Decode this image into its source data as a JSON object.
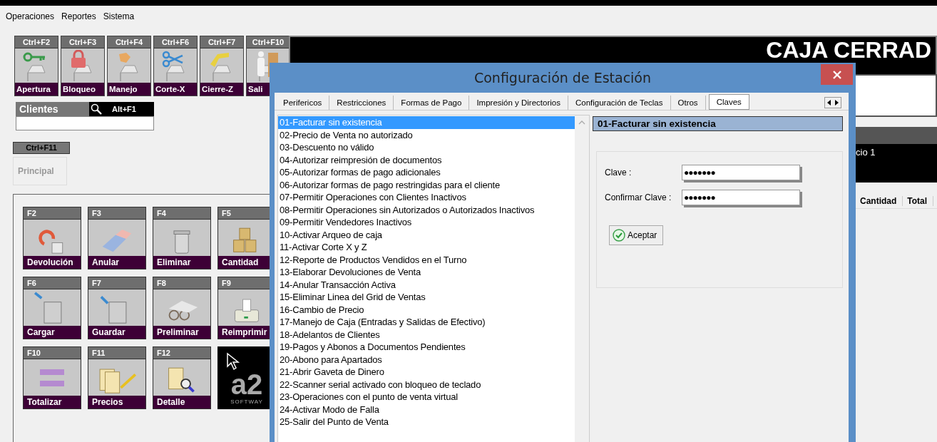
{
  "menu": [
    "Operaciones",
    "Reportes",
    "Sistema"
  ],
  "top_buttons": [
    {
      "shortcut": "Ctrl+F2",
      "label": "Apertura"
    },
    {
      "shortcut": "Ctrl+F3",
      "label": "Bloqueo"
    },
    {
      "shortcut": "Ctrl+F4",
      "label": "Manejo"
    },
    {
      "shortcut": "Ctrl+F6",
      "label": "Corte-X"
    },
    {
      "shortcut": "Ctrl+F7",
      "label": "Cierre-Z"
    },
    {
      "shortcut": "Ctrl+F10",
      "label": "Sali"
    }
  ],
  "clientes": {
    "label": "Clientes",
    "shortcut": "Alt+F1"
  },
  "principal": {
    "shortcut": "Ctrl+F11",
    "label": "Principal",
    "disabled": true
  },
  "function_keys": [
    {
      "key": "F2",
      "label": "Devolución"
    },
    {
      "key": "F3",
      "label": "Anular"
    },
    {
      "key": "F4",
      "label": "Eliminar"
    },
    {
      "key": "F5",
      "label": "Cantidad"
    },
    {
      "key": "F6",
      "label": "Cargar"
    },
    {
      "key": "F7",
      "label": "Guardar"
    },
    {
      "key": "F8",
      "label": "Preliminar"
    },
    {
      "key": "F9",
      "label": "Reimprimir"
    },
    {
      "key": "F10",
      "label": "Totalizar"
    },
    {
      "key": "F11",
      "label": "Precios"
    },
    {
      "key": "F12",
      "label": "Detalle"
    }
  ],
  "logo": {
    "text": "a2",
    "subtitle": "SOFTWAY"
  },
  "status_panel": {
    "title": "CAJA CERRAD",
    "caption": "cio 1"
  },
  "sales_table": {
    "columns": [
      "Cantidad",
      "Total"
    ]
  },
  "dialog": {
    "title": "Configuración de Estación",
    "tabs": [
      {
        "label": "Perifericos",
        "selected": false
      },
      {
        "label": "Restricciones",
        "selected": false
      },
      {
        "label": "Formas de Pago",
        "selected": false
      },
      {
        "label": "Impresión y Directorios",
        "selected": false
      },
      {
        "label": "Configuración de Teclas",
        "selected": false
      },
      {
        "label": "Otros",
        "selected": false
      },
      {
        "label": "Claves",
        "selected": true
      }
    ],
    "list": [
      {
        "label": "01-Facturar sin existencia",
        "selected": true
      },
      {
        "label": "02-Precio de Venta no autorizado",
        "selected": false
      },
      {
        "label": "03-Descuento no válido",
        "selected": false
      },
      {
        "label": "04-Autorizar reimpresión de documentos",
        "selected": false
      },
      {
        "label": "05-Autorizar formas de pago adicionales",
        "selected": false
      },
      {
        "label": "06-Autorizar formas de pago restringidas para el cliente",
        "selected": false
      },
      {
        "label": "07-Permitir Operaciones con Clientes Inactivos",
        "selected": false
      },
      {
        "label": "08-Permitir Operaciones sin Autorizados o Autorizados Inactivos",
        "selected": false
      },
      {
        "label": "09-Permitir Vendedores Inactivos",
        "selected": false
      },
      {
        "label": "10-Activar Arqueo de caja",
        "selected": false
      },
      {
        "label": "11-Activar Corte X y Z",
        "selected": false
      },
      {
        "label": "12-Reporte de Productos Vendidos en el Turno",
        "selected": false
      },
      {
        "label": "13-Elaborar Devoluciones de Venta",
        "selected": false
      },
      {
        "label": "14-Anular Transacción Activa",
        "selected": false
      },
      {
        "label": "15-Eliminar Linea del Grid de Ventas",
        "selected": false
      },
      {
        "label": "16-Cambio de Precio",
        "selected": false
      },
      {
        "label": "17-Manejo de Caja (Entradas y Salidas de Efectivo)",
        "selected": false
      },
      {
        "label": "18-Adelantos de Clientes",
        "selected": false
      },
      {
        "label": "19-Pagos y Abonos a Documentos Pendientes",
        "selected": false
      },
      {
        "label": "20-Abono para Apartados",
        "selected": false
      },
      {
        "label": "21-Abrir Gaveta de Dinero",
        "selected": false
      },
      {
        "label": "22-Scanner serial activado con bloqueo de teclado",
        "selected": false
      },
      {
        "label": "23-Operaciones con el punto de venta virtual",
        "selected": false
      },
      {
        "label": "24-Activar Modo de  Falla",
        "selected": false
      },
      {
        "label": "25-Salir del Punto de Venta",
        "selected": false
      }
    ],
    "detail": {
      "heading": "01-Facturar sin existencia",
      "fields": [
        {
          "label": "Clave :",
          "value": "●●●●●●●"
        },
        {
          "label": "Confirmar Clave :",
          "value": "●●●●●●●"
        }
      ],
      "button": "Aceptar"
    }
  }
}
